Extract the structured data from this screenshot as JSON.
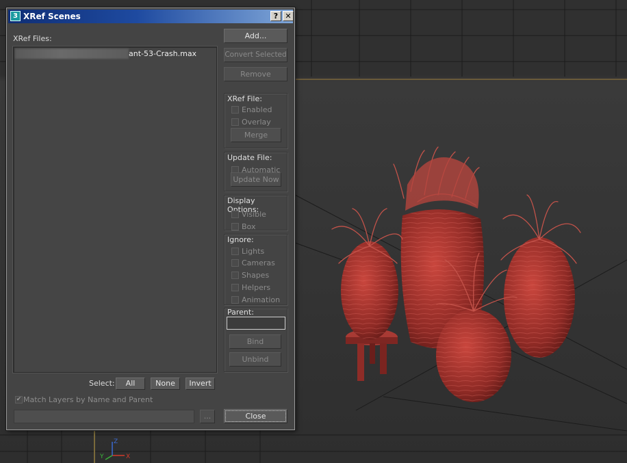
{
  "dialog": {
    "title": "XRef Scenes",
    "app_icon": "3",
    "help_glyph": "?",
    "close_glyph": "✕"
  },
  "files": {
    "label": "XRef Files:",
    "items": [
      {
        "visible_name": "ant-53-Crash.max",
        "path_obscured": true
      }
    ]
  },
  "actions": {
    "add": "Add...",
    "convert_selected": "Convert Selected",
    "remove": "Remove"
  },
  "xref_file": {
    "title": "XRef File:",
    "enabled": "Enabled",
    "overlay": "Overlay",
    "merge": "Merge"
  },
  "update_file": {
    "title": "Update File:",
    "automatic": "Automatic",
    "update_now": "Update Now"
  },
  "display_options": {
    "title": "Display Options:",
    "visible": "Visible",
    "box": "Box"
  },
  "ignore": {
    "title": "Ignore:",
    "lights": "Lights",
    "cameras": "Cameras",
    "shapes": "Shapes",
    "helpers": "Helpers",
    "animation": "Animation"
  },
  "parent": {
    "title": "Parent:",
    "value": "",
    "bind": "Bind",
    "unbind": "Unbind"
  },
  "select": {
    "label": "Select:",
    "all": "All",
    "none": "None",
    "invert": "Invert"
  },
  "match_layers": {
    "label": "Match Layers by Name and Parent",
    "checked": true
  },
  "footer": {
    "path_value": "",
    "browse": "...",
    "close": "Close"
  },
  "viewport": {
    "axis_labels": {
      "x": "X",
      "y": "Y",
      "z": "Z"
    },
    "plant_color": "#b83a33",
    "grid_color": "#1a1a1a"
  }
}
